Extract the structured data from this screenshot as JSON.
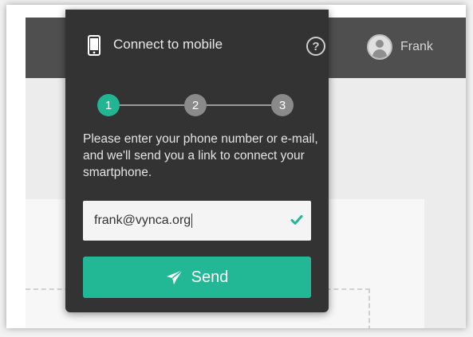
{
  "header": {
    "user_name": "Frank"
  },
  "popup": {
    "title": "Connect to mobile",
    "help_symbol": "?",
    "steps": [
      {
        "label": "1",
        "state": "active"
      },
      {
        "label": "2",
        "state": "inactive"
      },
      {
        "label": "3",
        "state": "inactive"
      }
    ],
    "instructions": "Please enter your phone number or e-mail, and we'll send you a link to connect your smartphone.",
    "input": {
      "value": "frank@vynca.org",
      "valid": true
    },
    "send_label": "Send"
  },
  "icons": {
    "phone": "smartphone-icon",
    "help": "help-icon",
    "check": "check-icon",
    "send": "paper-plane-icon",
    "avatar": "user-avatar-icon"
  },
  "colors": {
    "accent": "#22b795",
    "popup_bg": "#333333",
    "topbar_bg": "#4f4f4f",
    "step_inactive": "#8a8a8a"
  }
}
